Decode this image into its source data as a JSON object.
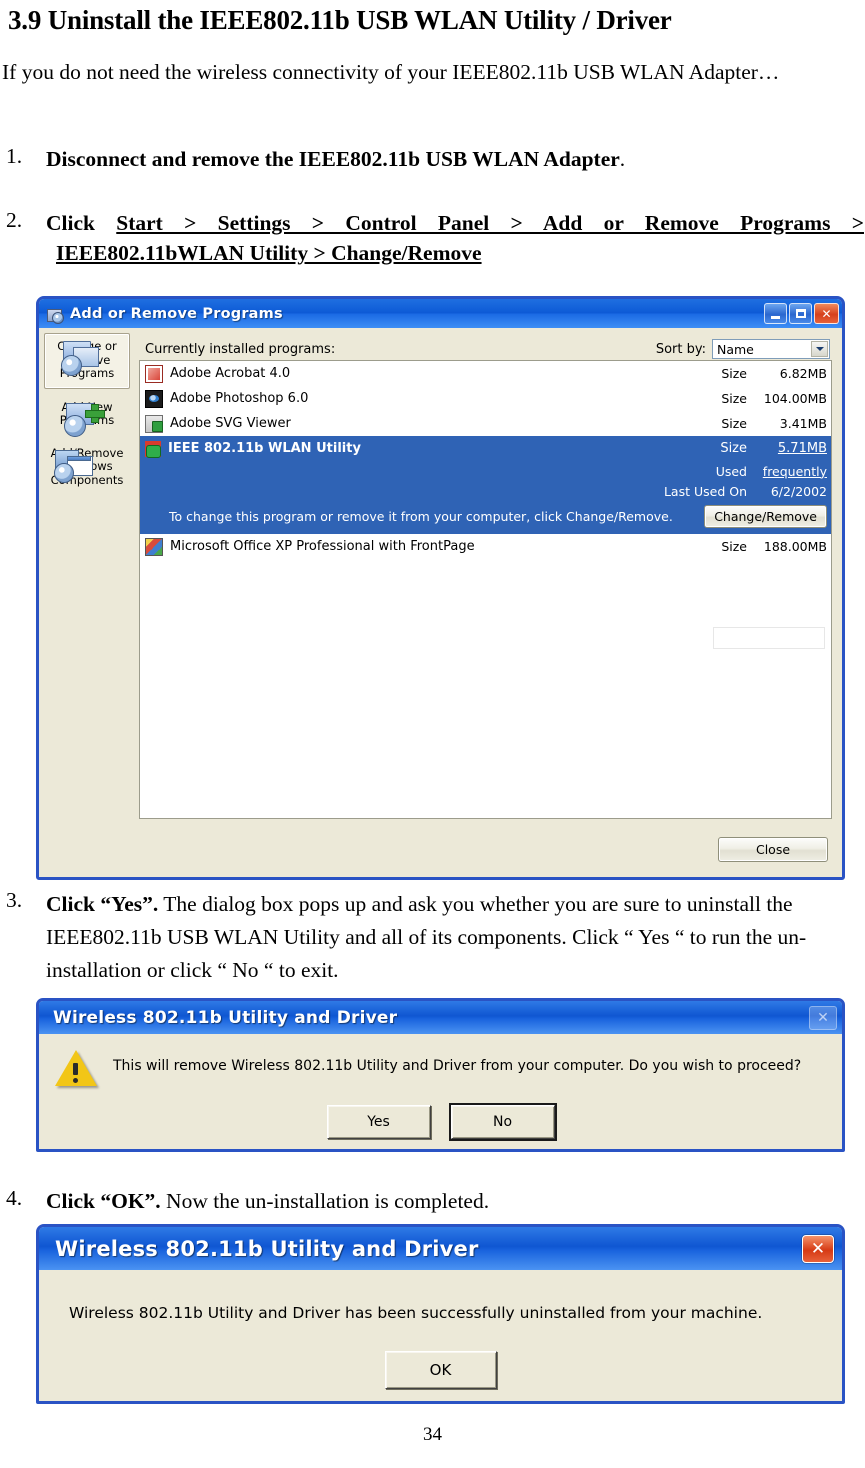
{
  "document": {
    "title": "3.9 Uninstall the IEEE802.11b USB WLAN Utility / Driver",
    "intro": "If you do not need the wireless connectivity of your IEEE802.11b USB WLAN Adapter…",
    "page_number": "34",
    "steps": [
      {
        "number": "1.",
        "bold": "Disconnect and remove the IEEE802.11b USB WLAN Adapter",
        "rest": "."
      },
      {
        "number": "2.",
        "line1_prefix": "Click ",
        "line1_path": "Start > Settings > Control Panel > Add or Remove Programs >",
        "line2_path": "IEEE802.11bWLAN Utility   >   Change/Remove"
      },
      {
        "number": "3.",
        "bold": "Click “Yes”.",
        "rest": " The dialog box pops up and ask you whether you are sure to uninstall the IEEE802.11b USB WLAN Utility and all of its components. Click “ Yes “ to run the un-installation or click “ No “ to exit."
      },
      {
        "number": "4.",
        "bold": "Click “OK”.",
        "rest": " Now the un-installation is completed."
      }
    ]
  },
  "add_remove_window": {
    "title": "Add or Remove Programs",
    "window_buttons": {
      "minimize": "–",
      "maximize": "□",
      "close": "✕"
    },
    "sidebar": [
      {
        "label_line1": "Change or",
        "label_line2": "Remove",
        "label_line3": "Programs",
        "icon": "change-remove-programs-icon",
        "selected": true
      },
      {
        "label_line1": "Add New",
        "label_line2": "Programs",
        "label_line3": "",
        "icon": "add-new-programs-icon",
        "selected": false
      },
      {
        "label_line1": "Add/Remove",
        "label_line2": "Windows",
        "label_line3": "Components",
        "icon": "add-remove-windows-components-icon",
        "selected": false
      }
    ],
    "installed_label": "Currently installed programs:",
    "sort_label": "Sort by:",
    "sort_value": "Name",
    "programs": [
      {
        "name": "Adobe Acrobat 4.0",
        "size_label": "Size",
        "size": "6.82MB",
        "icon": "adobe-acrobat-icon"
      },
      {
        "name": "Adobe Photoshop 6.0",
        "size_label": "Size",
        "size": "104.00MB",
        "icon": "adobe-photoshop-icon"
      },
      {
        "name": "Adobe SVG Viewer",
        "size_label": "Size",
        "size": "3.41MB",
        "icon": "adobe-svg-viewer-icon"
      }
    ],
    "selected_program": {
      "name": "IEEE 802.11b WLAN Utility",
      "icon": "wlan-utility-icon",
      "size_label": "Size",
      "size": "5.71MB",
      "used_label": "Used",
      "used_value": "frequently",
      "last_used_label": "Last Used On",
      "last_used_value": "6/2/2002",
      "hint": "To change this program or remove it from your computer, click Change/Remove.",
      "action_button": "Change/Remove"
    },
    "programs_after": [
      {
        "name": "Microsoft Office XP Professional with FrontPage",
        "size_label": "Size",
        "size": "188.00MB",
        "icon": "microsoft-office-icon"
      }
    ],
    "close_button": "Close"
  },
  "confirm_dialog": {
    "title": "Wireless 802.11b Utility and Driver",
    "message": "This will remove Wireless 802.11b Utility and Driver from your computer. Do you wish to proceed?",
    "yes_button": "Yes",
    "no_button": "No",
    "close_glyph": "✕"
  },
  "success_dialog": {
    "title": "Wireless 802.11b Utility and Driver",
    "message": "Wireless 802.11b Utility and Driver has been successfully uninstalled from your machine.",
    "ok_button": "OK",
    "close_glyph": "✕"
  },
  "colors": {
    "xp_title_blue": "#0d5ad6",
    "xp_face": "#ece9d8",
    "selection_blue": "#2f63b5",
    "window_border": "#2a53c4",
    "close_red": "#d63a14",
    "warning_yellow": "#f2c617"
  }
}
